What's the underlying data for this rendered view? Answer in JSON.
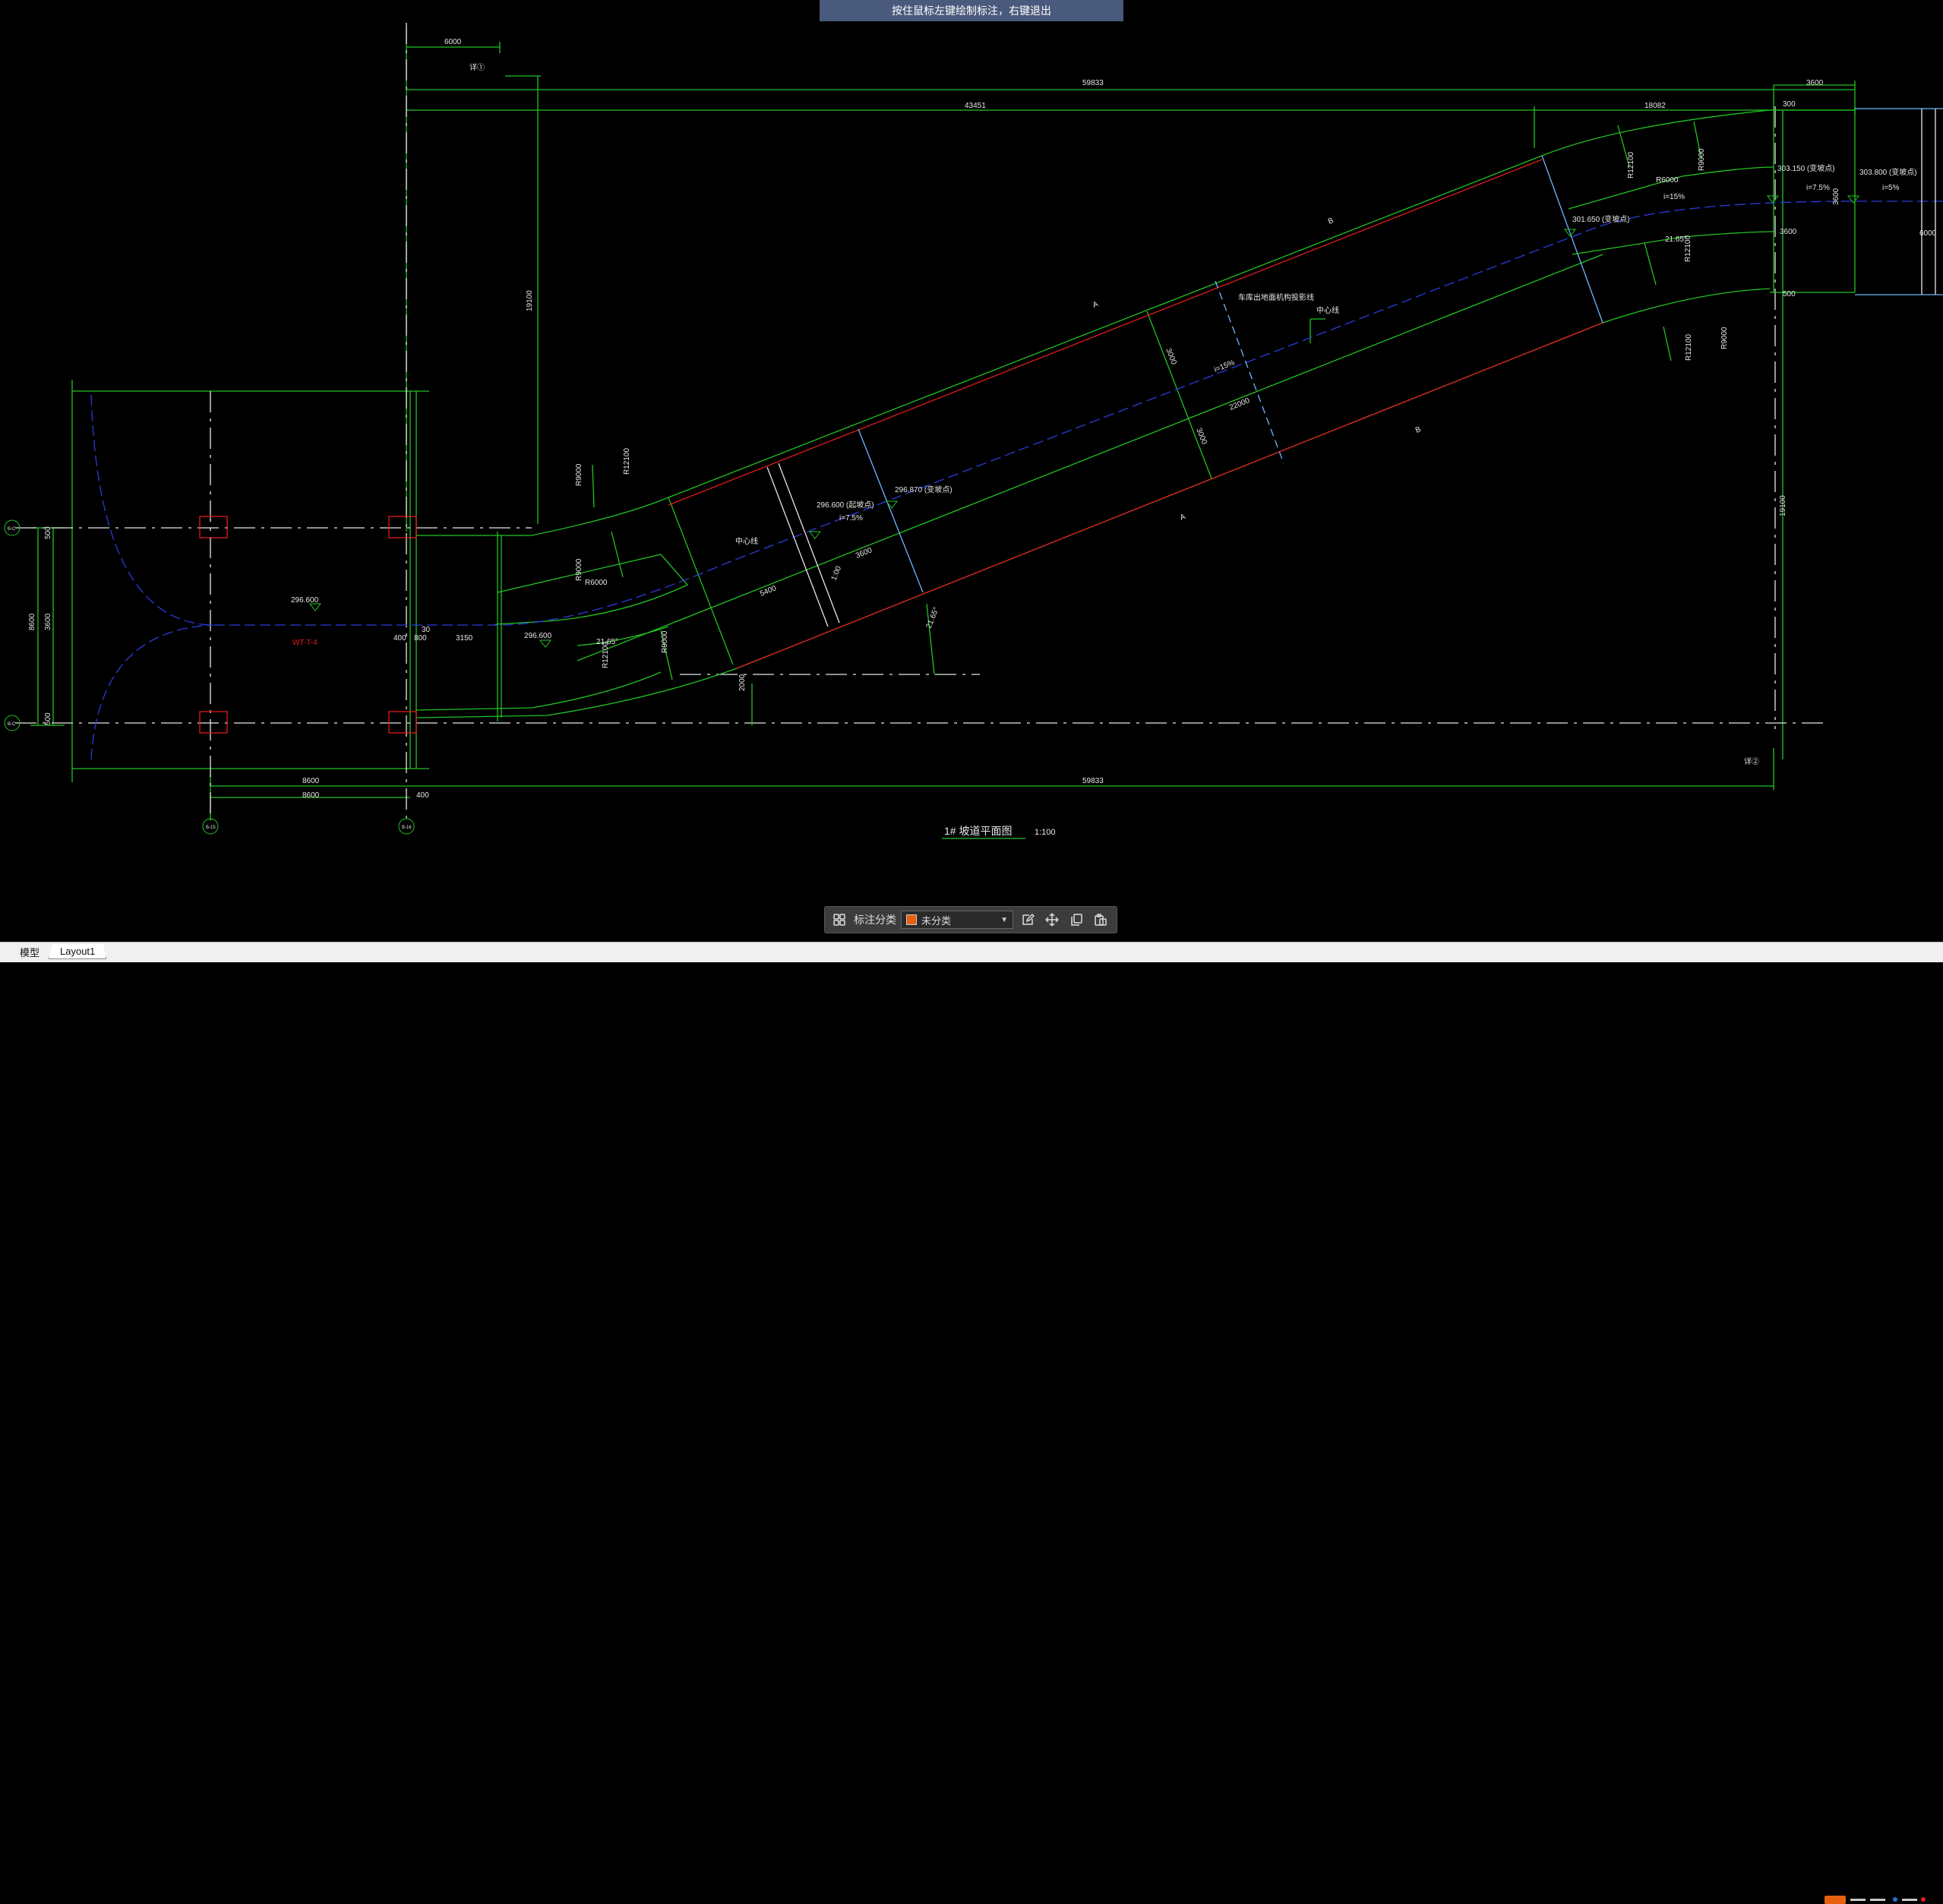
{
  "hint_bar": {
    "text": "按住鼠标左键绘制标注，右键退出"
  },
  "annotation_toolbar": {
    "category_label": "标注分类",
    "selected_category": "未分类",
    "swatch_color": "#e8600e",
    "icons": [
      "grid-icon",
      "edit-icon",
      "move-icon",
      "copy-icon",
      "paste-icon"
    ]
  },
  "layout_tabs": [
    {
      "label": "模型"
    },
    {
      "label": "Layout1"
    }
  ],
  "drawing": {
    "title": "1# 坡道平面图",
    "scale": "1:100",
    "colors": {
      "green": "#22c322",
      "red": "#e21c1c",
      "blue": "#2a3cdc",
      "white": "#e6e6e6",
      "light_blue": "#6fb6ff"
    },
    "dimensions": {
      "top_total": "59833",
      "top_inner": "43451",
      "top_seg": "18082",
      "top_right": "3600",
      "top_left": "6000",
      "vert_left": "19100",
      "vert_right": "19100",
      "bottom_total": "59833",
      "bottom_left_1": "8600",
      "bottom_left_2": "8600",
      "bottom_left_3": "400",
      "left_v1": "8600",
      "left_v2": "3600",
      "left_v3": "500",
      "left_v4": "500",
      "mid_1": "3150",
      "mid_2": "400",
      "mid_3": "800",
      "mid_4": "30",
      "right_1": "3600",
      "right_2": "3600",
      "right_3": "300",
      "right_4": "500",
      "right_w": "6000",
      "slope_len": "22000",
      "slope_w": "3000",
      "slope_w2": "3000",
      "ramp_1": "3600",
      "ramp_2": "5400",
      "ramp_3": "1:00",
      "bot_dim": "2000",
      "ang_1": "21.65°",
      "ang_2": "21.65°",
      "ang_3": "21.65°",
      "r_1": "R9000",
      "r_2": "R12100",
      "r_3": "R9000",
      "r_4": "R12100",
      "r_5": "R9000",
      "r_6": "R12100",
      "r_7": "R9000",
      "r_8": "R12100",
      "r_9": "R12100",
      "r_10": "R9000",
      "r_11": "R6000",
      "r_12": "R6000"
    },
    "elevations": {
      "e1": "296.600",
      "e2": "296.600",
      "e3": "296.600  (起坡点)",
      "e4": "296.870  (变坡点)",
      "e5": "301.650  (变坡点)",
      "e6": "303.150  (变坡点)",
      "e7": "303.800  (变坡点)"
    },
    "slopes": {
      "s1": "i=7.5%",
      "s2": "i=15%",
      "s3": "i=15%",
      "s4": "i=7.5%",
      "s5": "i=5%"
    },
    "labels": {
      "center_line_1": "中心线",
      "center_line_2": "中心线",
      "upper_projection": "车库出地面机构投影线",
      "red_note": "WT-T-4",
      "ref_1": "B",
      "ref_2": "B",
      "ref_3": "A",
      "ref_4": "A",
      "detail_1": "详①",
      "detail_2": "详②"
    },
    "axes": {
      "a1": "B-C",
      "a2": "B-C",
      "a3": "B-15",
      "a4": "B-16"
    }
  }
}
